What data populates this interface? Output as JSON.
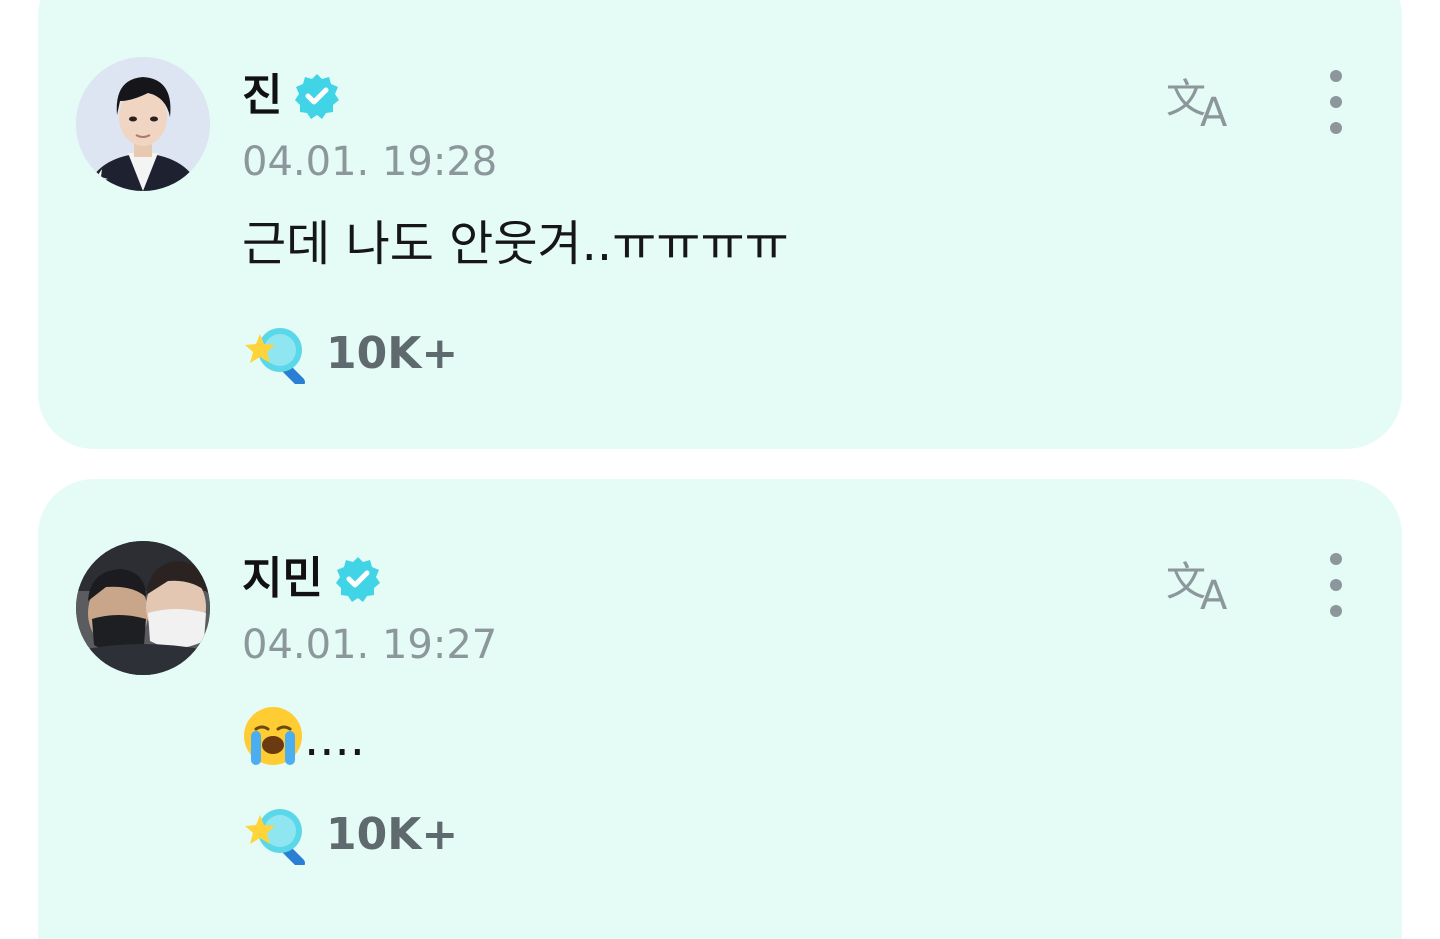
{
  "posts": [
    {
      "author": "진",
      "verified": true,
      "timestamp": "04.01. 19:28",
      "message": "근데 나도 안웃겨..ㅠㅠㅠㅠ",
      "reaction_count": "10K+"
    },
    {
      "author": "지민",
      "verified": true,
      "timestamp": "04.01. 19:27",
      "message_emoji": "loudly-crying-face",
      "message": "....",
      "reaction_count": "10K+"
    }
  ],
  "colors": {
    "card_background": "#e5fbf6",
    "verified_badge": "#41d3e6",
    "timestamp_text": "#8c979b",
    "icon_gray": "#8c979b"
  },
  "icons": {
    "verified": "verified-badge-icon",
    "translate": "translate-icon",
    "more": "more-vertical-icon",
    "reaction": "star-reaction-icon"
  }
}
